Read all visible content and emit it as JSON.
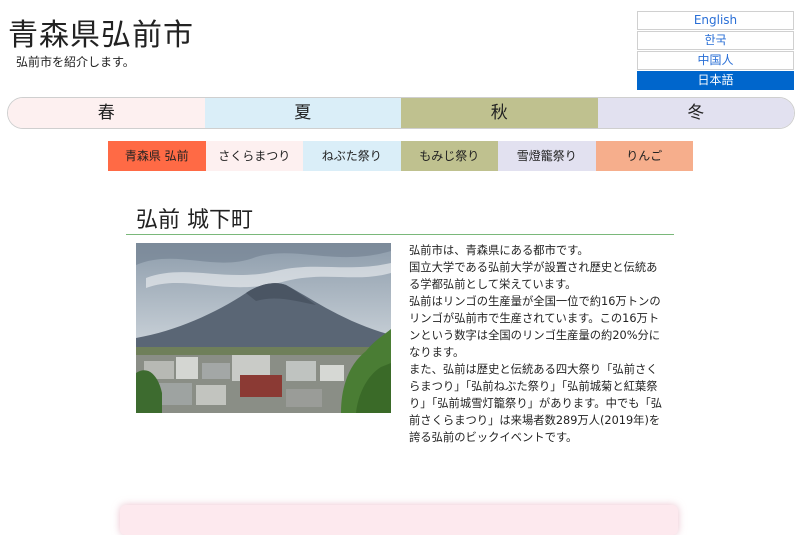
{
  "header": {
    "title": "青森県弘前市",
    "subtitle": "弘前市を紹介します。"
  },
  "languages": [
    {
      "label": "English",
      "active": false
    },
    {
      "label": "한국",
      "active": false
    },
    {
      "label": "中国人",
      "active": false
    },
    {
      "label": "日本語",
      "active": true
    }
  ],
  "seasons": [
    {
      "label": "春",
      "color": "#fdf0f0"
    },
    {
      "label": "夏",
      "color": "#daeef8"
    },
    {
      "label": "秋",
      "color": "#bfc18f"
    },
    {
      "label": "冬",
      "color": "#e2e1f0"
    }
  ],
  "subnav": [
    {
      "label": "青森県 弘前",
      "color": "#ff6a45"
    },
    {
      "label": "さくらまつり",
      "color": "#fdf0f0"
    },
    {
      "label": "ねぶた祭り",
      "color": "#daeef8"
    },
    {
      "label": "もみじ祭り",
      "color": "#bfc18f"
    },
    {
      "label": "雪燈籠祭り",
      "color": "#e2e1f0"
    },
    {
      "label": "りんご",
      "color": "#f6ae8c"
    }
  ],
  "section": {
    "title": "弘前 城下町",
    "paragraphs": [
      "弘前市は、青森県にある都市です。",
      "国立大学である弘前大学が設置され歴史と伝統ある学都弘前として栄えています。",
      "弘前はリンゴの生産量が全国一位で約16万トンのリンゴが弘前市で生産されています。この16万トンという数字は全国のリンゴ生産量の約20%分になります。",
      "また、弘前は歴史と伝統ある四大祭り「弘前さくらまつり」「弘前ねぶた祭り」「弘前城菊と紅葉祭り」「弘前城雪灯籠祭り」があります。中でも「弘前さくらまつり」は来場者数289万人(2019年)を誇る弘前のビックイベントです。"
    ]
  }
}
